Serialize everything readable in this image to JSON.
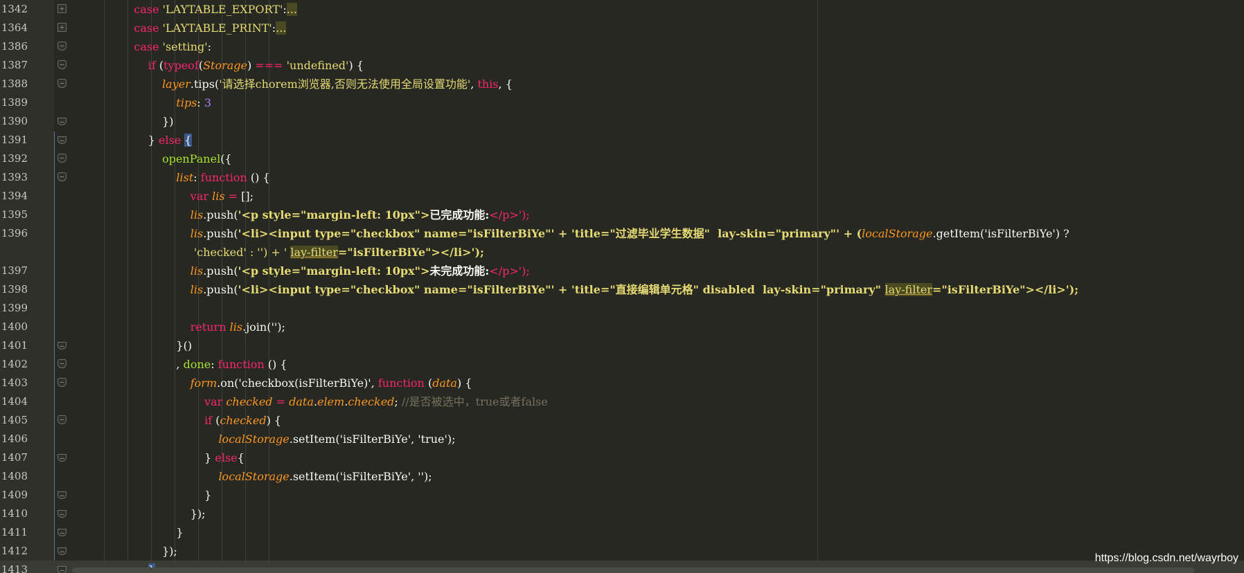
{
  "editor": {
    "lines": [
      {
        "n": "1342",
        "fold": "+",
        "code": "l1342"
      },
      {
        "n": "1364",
        "fold": "+",
        "code": "l1364"
      },
      {
        "n": "1386",
        "fold": "s",
        "code": "l1386"
      },
      {
        "n": "1387",
        "fold": "s",
        "code": "l1387"
      },
      {
        "n": "1388",
        "fold": "s",
        "code": "l1388"
      },
      {
        "n": "1389",
        "fold": "",
        "code": "l1389"
      },
      {
        "n": "1390",
        "fold": "e",
        "code": "l1390"
      },
      {
        "n": "1391",
        "fold": "e",
        "code": "l1391"
      },
      {
        "n": "1392",
        "fold": "s",
        "code": "l1392"
      },
      {
        "n": "1393",
        "fold": "s",
        "code": "l1393"
      },
      {
        "n": "1394",
        "fold": "",
        "code": "l1394"
      },
      {
        "n": "1395",
        "fold": "",
        "code": "l1395"
      },
      {
        "n": "1396",
        "fold": "",
        "code": "l1396"
      },
      {
        "n": "1397",
        "fold": "",
        "code": "l1397"
      },
      {
        "n": "1398",
        "fold": "",
        "code": "l1398"
      },
      {
        "n": "1399",
        "fold": "",
        "code": "l1399"
      },
      {
        "n": "1400",
        "fold": "",
        "code": "l1400"
      },
      {
        "n": "1401",
        "fold": "e",
        "code": "l1401"
      },
      {
        "n": "1402",
        "fold": "s",
        "code": "l1402"
      },
      {
        "n": "1403",
        "fold": "s",
        "code": "l1403"
      },
      {
        "n": "1404",
        "fold": "",
        "code": "l1404"
      },
      {
        "n": "1405",
        "fold": "s",
        "code": "l1405"
      },
      {
        "n": "1406",
        "fold": "",
        "code": "l1406"
      },
      {
        "n": "1407",
        "fold": "e",
        "code": "l1407"
      },
      {
        "n": "1408",
        "fold": "",
        "code": "l1408"
      },
      {
        "n": "1409",
        "fold": "e",
        "code": "l1409"
      },
      {
        "n": "1410",
        "fold": "e",
        "code": "l1410"
      },
      {
        "n": "1411",
        "fold": "e",
        "code": "l1411"
      },
      {
        "n": "1412",
        "fold": "e",
        "code": "l1412"
      },
      {
        "n": "1413",
        "fold": "e",
        "code": "l1413"
      }
    ],
    "tokens": {
      "case": "case",
      "export": "'LAYTABLE_EXPORT'",
      "print": "'LAYTABLE_PRINT'",
      "setting": "'setting'",
      "ellipsis": "...",
      "if": "if",
      "typeof": "typeof",
      "storage": "Storage",
      "undefined_str": "'undefined'",
      "layer": "layer",
      "tips_call": ".tips(",
      "tips_str": "'请选择chorem浏览器,否则无法使用全局设置功能'",
      "this": "this",
      "tips_prop": "tips",
      "three": "3",
      "else": "else",
      "openPanel": "openPanel",
      "list": "list",
      "function": "function",
      "var": "var",
      "lis": "lis",
      "push": ".push(",
      "p_open": "'<p style=\"margin-left: 10px\">",
      "done_text": "已完成功能:",
      "undone_text": "未完成功能:",
      "p_close": "</p>');",
      "li_input": "'<li><input type=\"checkbox\" name=\"isFilterBiYe\"' + '",
      "title1": "title=\"过滤毕业学生数据\"  lay-skin=\"primary\"' + (",
      "localStorage": "localStorage",
      "getItem": ".getItem('isFilterBiYe') ?",
      "checked_cont": "'checked' : '') + ' ",
      "layfilter": "lay-filter",
      "layfilter_val": "=\"isFilterBiYe\"></li>');",
      "title2": "title=\"直接编辑单元格\" disabled  lay-skin=\"primary\" ",
      "layfilter_val2": "=\"isFilterBiYe\"></li>');",
      "return": "return",
      "join": ".join('');",
      "done": "done",
      "form": "form",
      "on_call": ".on('checkbox(isFilterBiYe)',",
      "data": "data",
      "checked": "checked",
      "elem": "elem",
      "comment": "//是否被选中，true或者false",
      "setItem_true": ".setItem('isFilterBiYe', 'true');",
      "setItem_empty": ".setItem('isFilterBiYe', '');"
    }
  },
  "watermark": "https://blog.csdn.net/wayrboy"
}
